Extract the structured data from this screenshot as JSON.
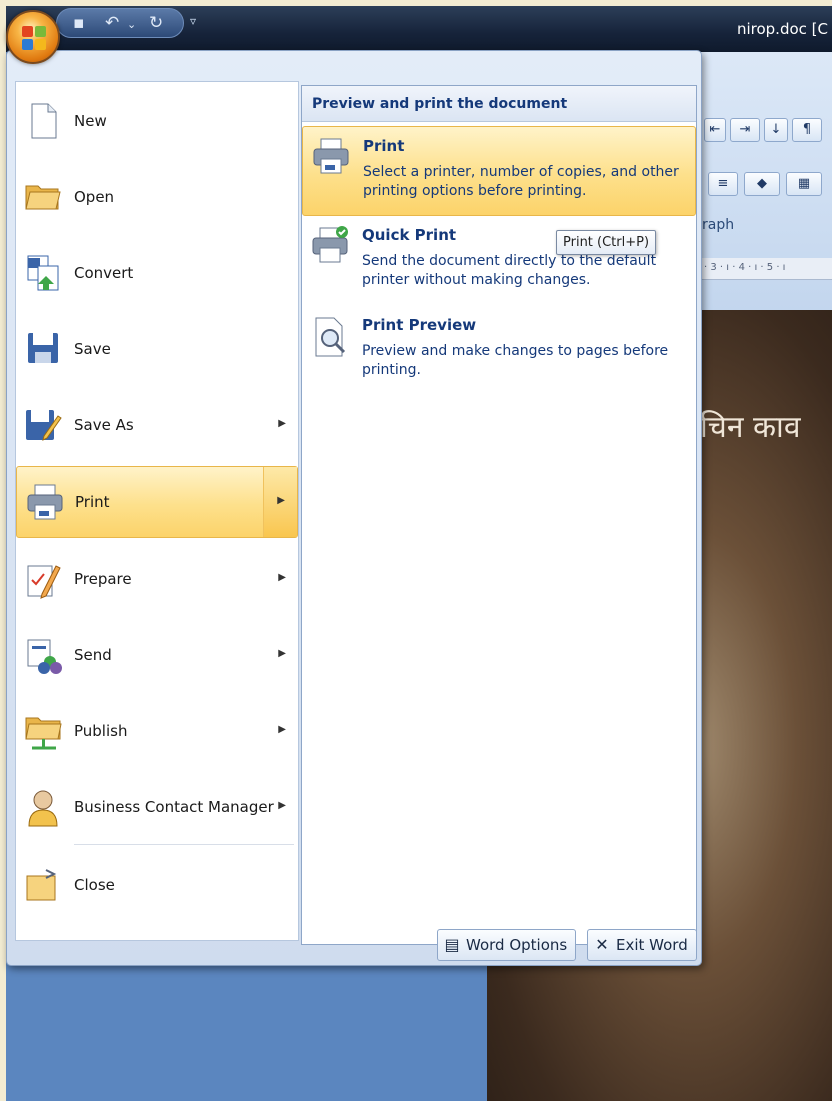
{
  "window": {
    "title": "nirop.doc [C"
  },
  "quick_access": {
    "save_icon": "save-icon",
    "undo_icon": "undo-icon",
    "redo_icon": "redo-icon",
    "more_glyph": "▿"
  },
  "background_doc": {
    "ribbon_group_label": "raph",
    "ruler_text": "· 3 · ı · 4 · ı · 5 · ı",
    "text": "चिन काव"
  },
  "menu": {
    "items": [
      {
        "label": "New",
        "icon": "new-document-icon"
      },
      {
        "label": "Open",
        "icon": "open-folder-icon"
      },
      {
        "label": "Convert",
        "icon": "convert-icon"
      },
      {
        "label": "Save",
        "icon": "save-icon"
      },
      {
        "label": "Save As",
        "icon": "save-as-icon",
        "submenu": true
      },
      {
        "label": "Print",
        "icon": "printer-icon",
        "submenu": true,
        "selected": true
      },
      {
        "label": "Prepare",
        "icon": "prepare-icon",
        "submenu": true
      },
      {
        "label": "Send",
        "icon": "send-icon",
        "submenu": true
      },
      {
        "label": "Publish",
        "icon": "publish-icon",
        "submenu": true
      },
      {
        "label": "Business Contact Manager",
        "icon": "contact-manager-icon",
        "submenu": true
      },
      {
        "label": "Close",
        "icon": "close-folder-icon"
      }
    ],
    "submenu": {
      "header": "Preview and print the document",
      "items": [
        {
          "title": "Print",
          "description": "Select a printer, number of copies, and other printing options before printing.",
          "selected": true
        },
        {
          "title": "Quick Print",
          "description": "Send the document directly to the default printer without making changes."
        },
        {
          "title": "Print Preview",
          "description": "Preview and make changes to pages before printing."
        }
      ]
    },
    "tooltip": "Print (Ctrl+P)",
    "buttons": {
      "word_options": "Word Options",
      "exit_word": "Exit Word"
    }
  }
}
